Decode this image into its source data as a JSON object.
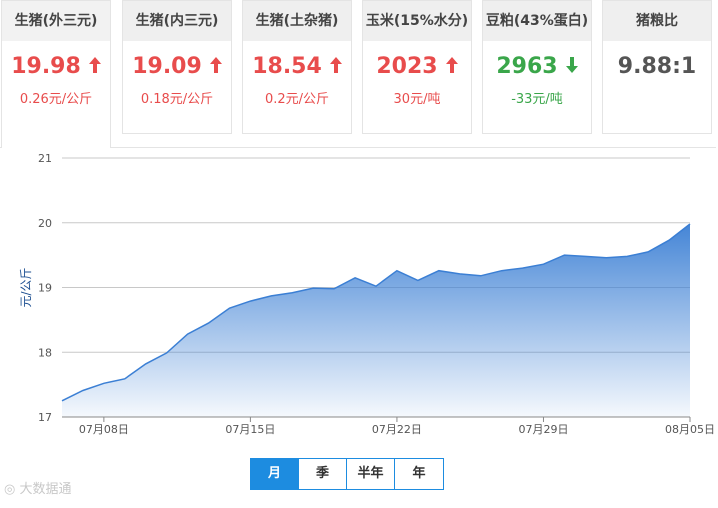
{
  "cards": [
    {
      "title": "生猪(外三元)",
      "value": "19.98",
      "change": "0.26元/公斤",
      "trend": "up"
    },
    {
      "title": "生猪(内三元)",
      "value": "19.09",
      "change": "0.18元/公斤",
      "trend": "up"
    },
    {
      "title": "生猪(土杂猪)",
      "value": "18.54",
      "change": "0.2元/公斤",
      "trend": "up"
    },
    {
      "title": "玉米(15%水分)",
      "value": "2023",
      "change": "30元/吨",
      "trend": "up"
    },
    {
      "title": "豆粕(43%蛋白)",
      "value": "2963",
      "change": "-33元/吨",
      "trend": "down"
    },
    {
      "title": "猪粮比",
      "value": "9.88:1",
      "change": "",
      "trend": "none"
    }
  ],
  "colors": {
    "up": "#e84c4c",
    "down": "#3aa64a",
    "accent": "#1d8ce0",
    "line": "#3b7fd4"
  },
  "chart_data": {
    "type": "area",
    "title": "",
    "xlabel": "",
    "ylabel": "元/公斤",
    "ylim": [
      17,
      21
    ],
    "yticks": [
      "17",
      "18",
      "19",
      "20",
      "21"
    ],
    "xtick_labels": [
      "07月08日",
      "07月15日",
      "07月22日",
      "07月29日",
      "08月05日"
    ],
    "grid": true,
    "x": [
      "07月06日",
      "07月07日",
      "07月08日",
      "07月09日",
      "07月10日",
      "07月11日",
      "07月12日",
      "07月13日",
      "07月14日",
      "07月15日",
      "07月16日",
      "07月17日",
      "07月18日",
      "07月19日",
      "07月20日",
      "07月21日",
      "07月22日",
      "07月23日",
      "07月24日",
      "07月25日",
      "07月26日",
      "07月27日",
      "07月28日",
      "07月29日",
      "07月30日",
      "07月31日",
      "08月01日",
      "08月02日",
      "08月03日",
      "08月04日",
      "08月05日"
    ],
    "series": [
      {
        "values": [
          17.25,
          17.41,
          17.52,
          17.59,
          17.82,
          17.99,
          18.28,
          18.45,
          18.68,
          18.79,
          18.87,
          18.92,
          18.99,
          18.98,
          19.15,
          19.02,
          19.26,
          19.11,
          19.26,
          19.21,
          19.18,
          19.26,
          19.3,
          19.36,
          19.5,
          19.48,
          19.46,
          19.48,
          19.55,
          19.73,
          19.98
        ]
      }
    ]
  },
  "tabs": [
    {
      "label": "月",
      "selected": true
    },
    {
      "label": "季",
      "selected": false
    },
    {
      "label": "半年",
      "selected": false
    },
    {
      "label": "年",
      "selected": false
    }
  ],
  "watermark": "大数据通"
}
